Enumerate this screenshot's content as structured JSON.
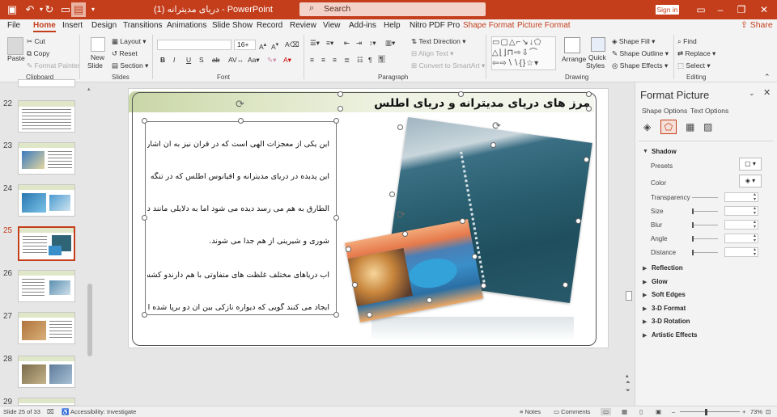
{
  "titlebar": {
    "doc_title": "دریای مدیترانه (1)  -  PowerPoint",
    "search_placeholder": "Search",
    "signin": "Sign in",
    "autosave_icon": "save-icon",
    "undo_icon": "undo-icon",
    "redo_icon": "redo-icon",
    "brand_color": "#c43e1c"
  },
  "tabs": [
    "File",
    "Home",
    "Insert",
    "Design",
    "Transitions",
    "Animations",
    "Slide Show",
    "Record",
    "Review",
    "View",
    "Add-ins",
    "Help",
    "Nitro PDF Pro",
    "Shape Format",
    "Picture Format"
  ],
  "active_tab": "Home",
  "share": "Share",
  "ribbon": {
    "clipboard": {
      "paste": "Paste",
      "cut": "Cut",
      "copy": "Copy",
      "format_painter": "Format Painter",
      "group": "Clipboard"
    },
    "slides": {
      "new_slide_line1": "New",
      "new_slide_line2": "Slide",
      "layout": "Layout",
      "reset": "Reset",
      "section": "Section",
      "group": "Slides"
    },
    "font": {
      "font_name": "",
      "font_size": "16+",
      "group": "Font",
      "bold": "B",
      "italic": "I",
      "underline": "U",
      "strike": "S"
    },
    "paragraph": {
      "text_direction": "Text Direction",
      "align_text": "Align Text",
      "smartart": "Convert to SmartArt",
      "group": "Paragraph"
    },
    "drawing": {
      "arrange": "Arrange",
      "quick_styles_1": "Quick",
      "quick_styles_2": "Styles",
      "shape_fill": "Shape Fill",
      "shape_outline": "Shape Outline",
      "shape_effects": "Shape Effects",
      "group": "Drawing"
    },
    "editing": {
      "find": "Find",
      "replace": "Replace",
      "select": "Select",
      "group": "Editing"
    }
  },
  "thumbnails": [
    {
      "num": "22",
      "active": false
    },
    {
      "num": "23",
      "active": false
    },
    {
      "num": "24",
      "active": false
    },
    {
      "num": "25",
      "active": true
    },
    {
      "num": "26",
      "active": false
    },
    {
      "num": "27",
      "active": false
    },
    {
      "num": "28",
      "active": false
    },
    {
      "num": "29",
      "active": false
    }
  ],
  "slide": {
    "title": "مرز های دریای مدیترانه و دریای اطلس",
    "paragraphs": [
      "این یکی از معجزات الهی است که در قرآن نیز به آن اشاره شده است.",
      "این پدیده در دریای مدیترانه و اقیانوس اطلس که در تنگه جبل",
      "الطارق به هم می رسد دیده می شود اما به دلایلی مانند دما میزان",
      "شوری و شیرینی از هم جدا می شوند.",
      "آب دریاهای مختلف غلظت های متفاوتی با هم دارندو کشش سطحی",
      "ایجاد می کنند گویی که دیواره نازکی بین آن دو برپا شده است."
    ]
  },
  "format_pane": {
    "title": "Format Picture",
    "tab_shape": "Shape Options",
    "tab_text": "Text Options",
    "shadow": "Shadow",
    "rows": [
      "Presets",
      "Color",
      "Transparency",
      "Size",
      "Blur",
      "Angle",
      "Distance"
    ],
    "sections": [
      "Reflection",
      "Glow",
      "Soft Edges",
      "3-D Format",
      "3-D Rotation",
      "Artistic Effects"
    ]
  },
  "status": {
    "slide_of": "Slide 25 of 33",
    "accessibility": "Accessibility: Investigate",
    "notes": "Notes",
    "comments": "Comments",
    "zoom": "73%"
  }
}
